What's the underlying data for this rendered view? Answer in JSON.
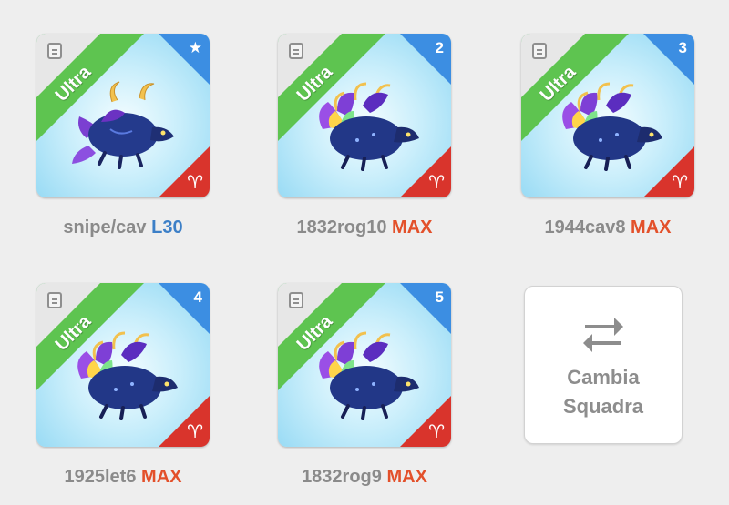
{
  "cards": [
    {
      "rarity": "Ultra",
      "badge": "★",
      "badge_icon": "star-icon",
      "sign": "♈",
      "name": "snipe/cav",
      "level": "L30",
      "level_color": "blue"
    },
    {
      "rarity": "Ultra",
      "badge": "2",
      "sign": "♈",
      "name": "1832rog10",
      "level": "MAX",
      "level_color": "red"
    },
    {
      "rarity": "Ultra",
      "badge": "3",
      "sign": "♈",
      "name": "1944cav8",
      "level": "MAX",
      "level_color": "red"
    },
    {
      "rarity": "Ultra",
      "badge": "4",
      "sign": "♈",
      "name": "1925let6",
      "level": "MAX",
      "level_color": "red"
    },
    {
      "rarity": "Ultra",
      "badge": "5",
      "sign": "♈",
      "name": "1832rog9",
      "level": "MAX",
      "level_color": "red"
    }
  ],
  "swap": {
    "line1": "Cambia",
    "line2": "Squadra",
    "icon": "swap-arrows-icon"
  },
  "colors": {
    "ultra_green": "#5ec450",
    "badge_blue": "#3c8ee2",
    "sign_red": "#d9342c",
    "level_blue": "#3c7fc7",
    "level_red": "#e3502a"
  }
}
